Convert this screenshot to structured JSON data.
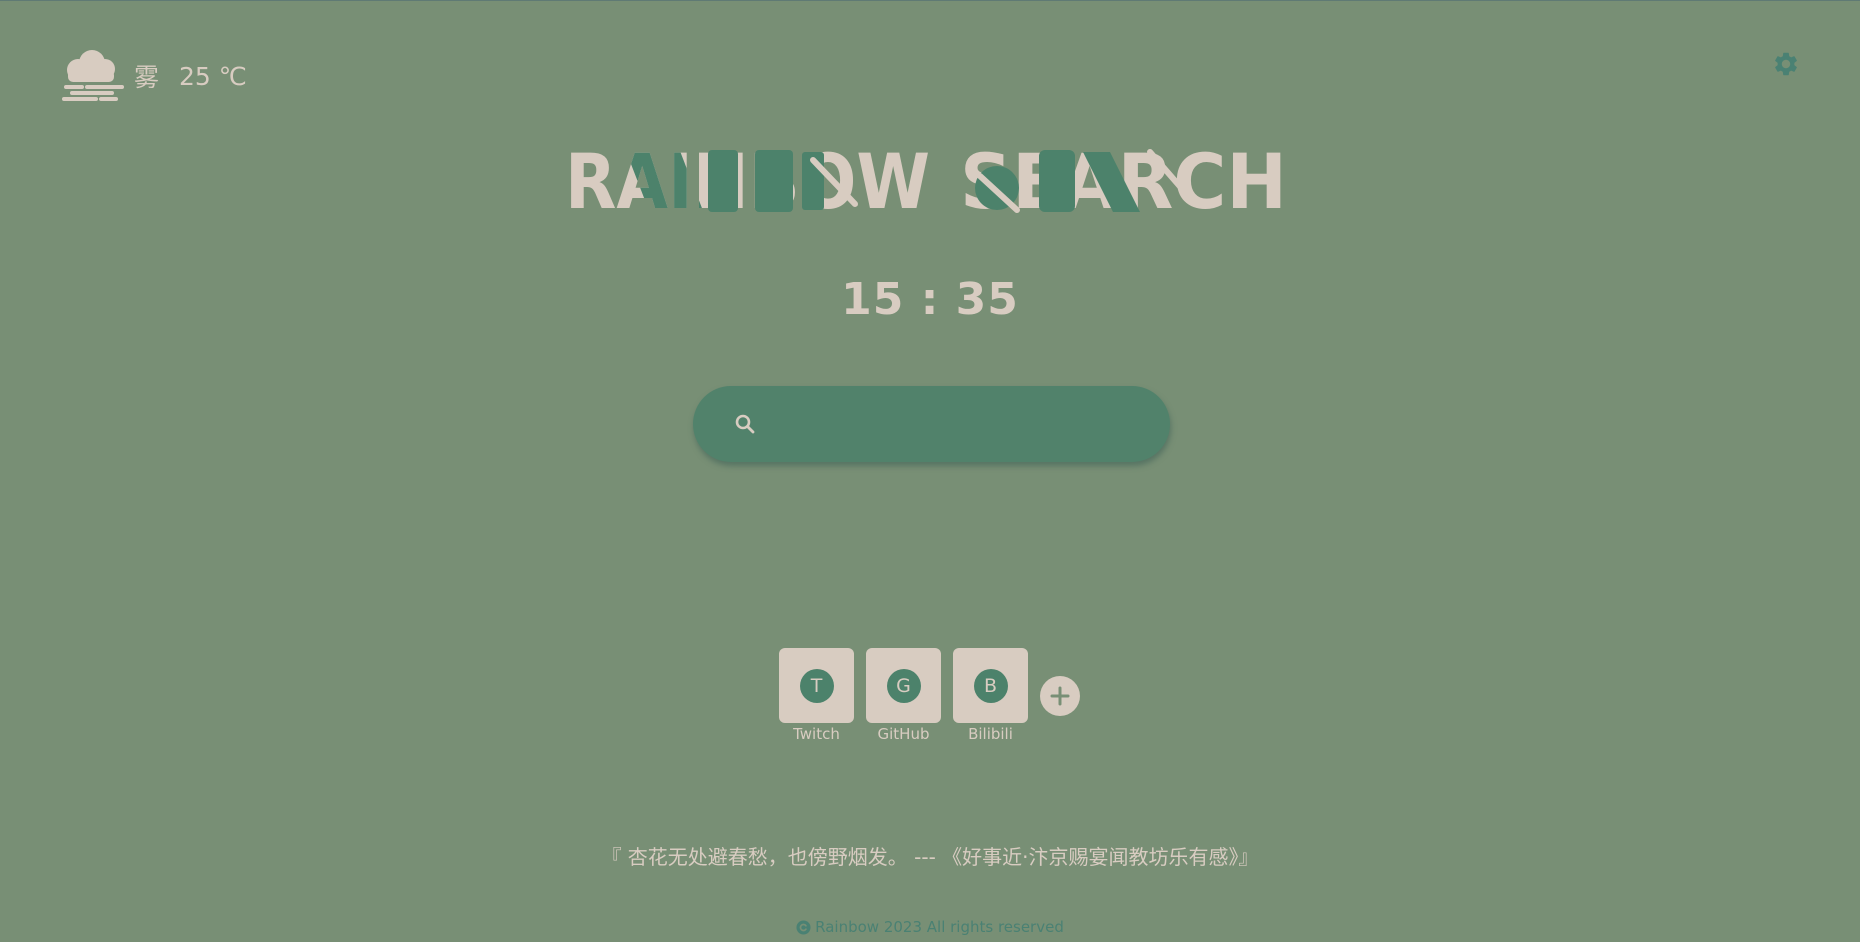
{
  "weather": {
    "icon": "fog-icon",
    "condition": "雾",
    "temperature": "25 ℃"
  },
  "settings": {
    "icon": "gear-icon"
  },
  "logo": {
    "text": "RAINBOW SEARCH"
  },
  "clock": {
    "time": "15 : 35"
  },
  "search": {
    "icon": "search-icon",
    "value": "",
    "placeholder": ""
  },
  "shortcuts": [
    {
      "initial": "T",
      "label": "Twitch"
    },
    {
      "initial": "G",
      "label": "GitHub"
    },
    {
      "initial": "B",
      "label": "Bilibili"
    }
  ],
  "add_shortcut": {
    "icon": "plus-icon"
  },
  "quote": {
    "text": "『 杏花无处避春愁，也傍野烟发。 --- 《好事近·汴京赐宴闻教坊乐有感》』"
  },
  "footer": {
    "icon": "copyright-icon",
    "text": "Rainbow 2023 All rights reserved"
  },
  "colors": {
    "background": "#788f75",
    "accent": "#51826b",
    "cream": "#d8ccc1",
    "footer_text": "#4a8173"
  }
}
